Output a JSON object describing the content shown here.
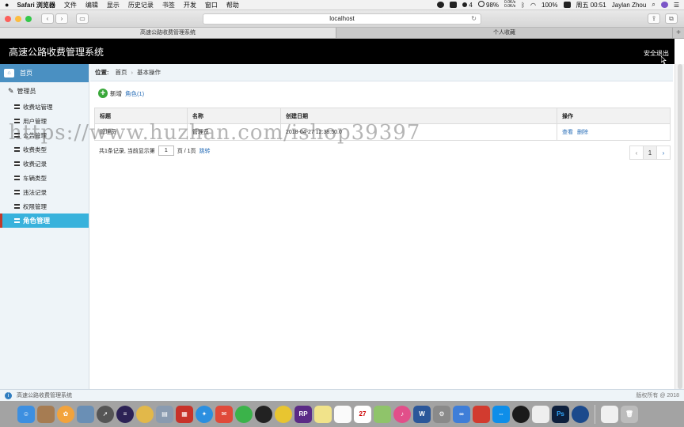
{
  "menubar": {
    "app_name": "Safari 浏览器",
    "menus": [
      "文件",
      "编辑",
      "显示",
      "历史记录",
      "书签",
      "开发",
      "窗口",
      "帮助"
    ],
    "notif_count": "4",
    "battery": "98%",
    "net_up": "0.0K/s",
    "net_down": "0.0K/s",
    "volume_pct": "100%",
    "clock": "周五 00:51",
    "user": "Jaylan Zhou"
  },
  "browser": {
    "address": "localhost",
    "tabs": [
      "高速公路收费管理系统",
      "个人收藏"
    ]
  },
  "header": {
    "title": "高速公路收费管理系统",
    "logout": "安全退出"
  },
  "sidebar": {
    "home": "首页",
    "section": "管理员",
    "items": [
      "收费站管理",
      "用户管理",
      "公告管理",
      "收费类型",
      "收费记录",
      "车辆类型",
      "违法记录",
      "权限管理",
      "角色管理"
    ]
  },
  "breadcrumb": {
    "label": "位置:",
    "home": "首页",
    "current": "基本操作"
  },
  "actions": {
    "add": "新增",
    "role": "角色(1)"
  },
  "table": {
    "columns": [
      "标题",
      "名称",
      "创建日期",
      "操作"
    ],
    "rows": [
      {
        "title": "管理员",
        "name": "管理员",
        "created": "2018-04-27 12:38:50.0",
        "view": "查看",
        "delete": "删除"
      }
    ]
  },
  "pager": {
    "total_prefix": "共1条记录,  当前显示第",
    "current_page": "1",
    "pages_suffix": "页 / 1页",
    "jump": "跳转",
    "page_btn": "1"
  },
  "watermark": "https://www.huzhan.com/ishop39397",
  "statusbar": {
    "left": "高速公路收费管理系统",
    "right": "版权所有 @ 2018"
  },
  "colors": {
    "header_bg": "#000000",
    "sidebar_bg": "#eef4f8",
    "active_item": "#38b2dc",
    "link": "#2a6fb8"
  }
}
